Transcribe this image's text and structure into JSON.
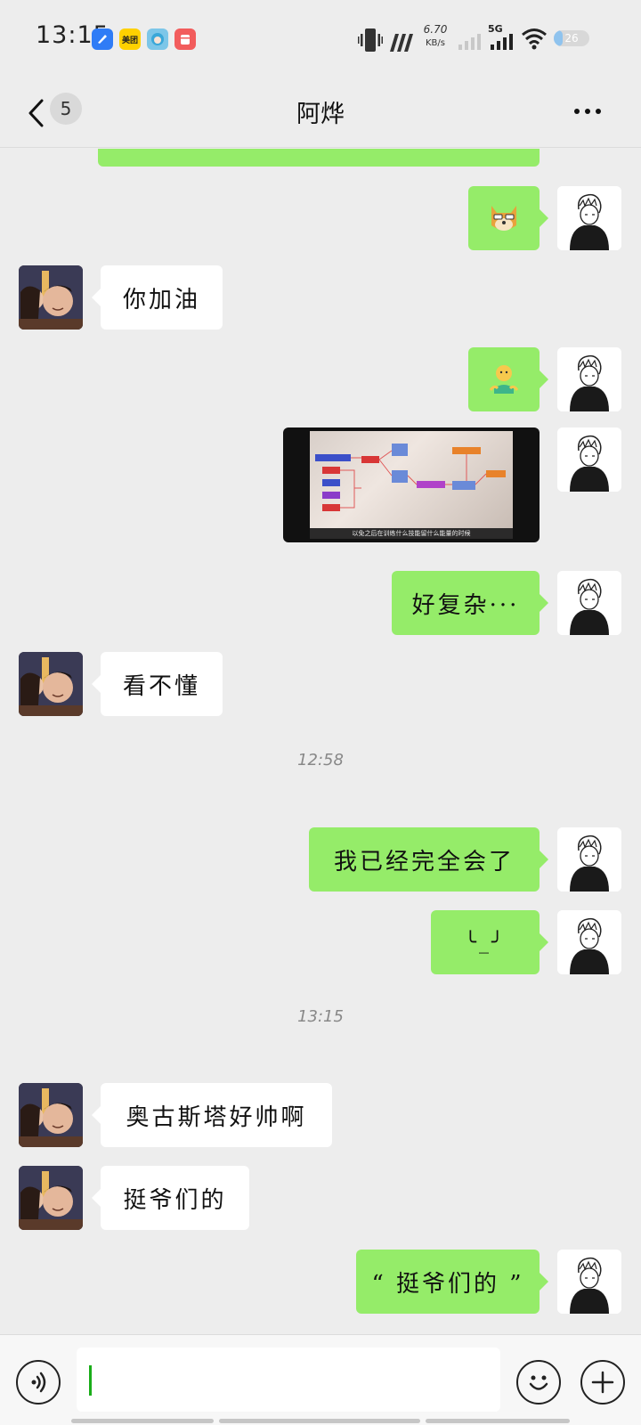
{
  "status_bar": {
    "time": "13:15",
    "app_icons": [
      "app-blue-icon",
      "meituan-icon",
      "anime-app-icon",
      "red-app-icon"
    ],
    "meituan_label": "美团",
    "net_speed_value": "6.70",
    "net_speed_unit": "KB/s",
    "network_label": "5G",
    "battery_level": "26"
  },
  "header": {
    "unread_count": "5",
    "title": "阿烨"
  },
  "messages": [
    {
      "side": "self",
      "type": "sticker",
      "sticker": "doge-icon"
    },
    {
      "side": "other",
      "type": "text",
      "text": "你加油"
    },
    {
      "side": "self",
      "type": "sticker",
      "sticker": "person-shrug-icon"
    },
    {
      "side": "self",
      "type": "video",
      "caption": "以免之后在训练什么技能留什么能量的时候"
    },
    {
      "side": "self",
      "type": "text",
      "text": "好复杂···"
    },
    {
      "side": "other",
      "type": "text",
      "text": "看不懂"
    },
    {
      "type": "time",
      "text": "12:58"
    },
    {
      "side": "self",
      "type": "text",
      "text": "我已经完全会了"
    },
    {
      "side": "self",
      "type": "text",
      "text": "╰_╯"
    },
    {
      "type": "time",
      "text": "13:15"
    },
    {
      "side": "other",
      "type": "text",
      "text": "奥古斯塔好帅啊"
    },
    {
      "side": "other",
      "type": "text",
      "text": "挺爷们的"
    },
    {
      "side": "self",
      "type": "text",
      "text": "“ 挺爷们的 ”"
    }
  ],
  "input": {
    "value": "",
    "placeholder": ""
  },
  "colors": {
    "self_bubble": "#95ec69",
    "other_bubble": "#ffffff",
    "background": "#ededed",
    "caret": "#1aad19"
  }
}
